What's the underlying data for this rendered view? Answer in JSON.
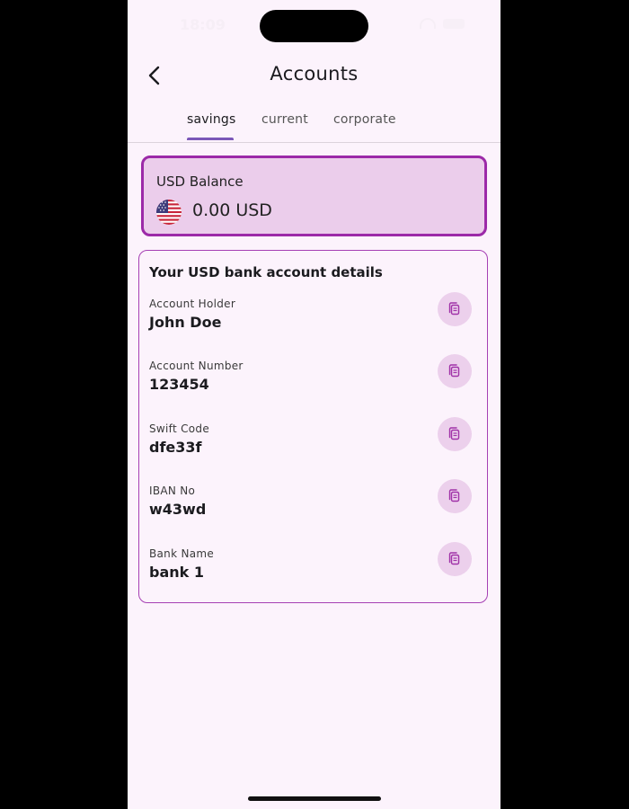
{
  "status_bar": {
    "time": "18:09"
  },
  "header": {
    "title": "Accounts"
  },
  "tabs": [
    {
      "label": "savings",
      "active": true
    },
    {
      "label": "current",
      "active": false
    },
    {
      "label": "corporate",
      "active": false
    }
  ],
  "balance": {
    "label": "USD Balance",
    "value": "0.00 USD",
    "flag_icon": "us-flag-icon"
  },
  "details": {
    "title": "Your USD bank account details",
    "rows": [
      {
        "label": "Account Holder",
        "value": "John Doe"
      },
      {
        "label": "Account Number",
        "value": "123454"
      },
      {
        "label": "Swift Code",
        "value": "dfe33f"
      },
      {
        "label": "IBAN No",
        "value": "w43wd"
      },
      {
        "label": "Bank Name",
        "value": "bank 1"
      }
    ]
  },
  "colors": {
    "accent": "#9c2aa8",
    "card_fill": "#ebcdeb",
    "background": "#fcf3fc",
    "tab_indicator": "#7b57b8"
  }
}
